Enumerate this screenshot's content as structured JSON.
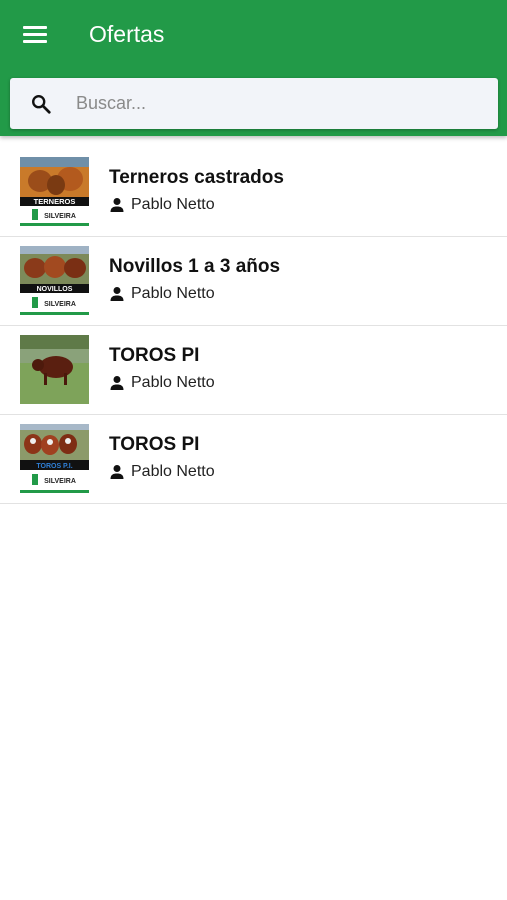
{
  "header": {
    "title": "Ofertas",
    "menu_icon": "menu-icon",
    "background": "#229a48"
  },
  "search": {
    "placeholder": "Buscar...",
    "value": "",
    "icon": "search-icon"
  },
  "offers": [
    {
      "title": "Terneros castrados",
      "author": "Pablo Netto",
      "thumb_caption": "TERNEROS",
      "brand": "SILVEIRA"
    },
    {
      "title": "Novillos 1 a 3 años",
      "author": "Pablo Netto",
      "thumb_caption": "NOVILLOS",
      "brand": "SILVEIRA"
    },
    {
      "title": "TOROS PI",
      "author": "Pablo Netto",
      "thumb_caption": "",
      "brand": ""
    },
    {
      "title": "TOROS PI",
      "author": "Pablo Netto",
      "thumb_caption": "TOROS P.I.",
      "brand": "SILVEIRA"
    }
  ]
}
